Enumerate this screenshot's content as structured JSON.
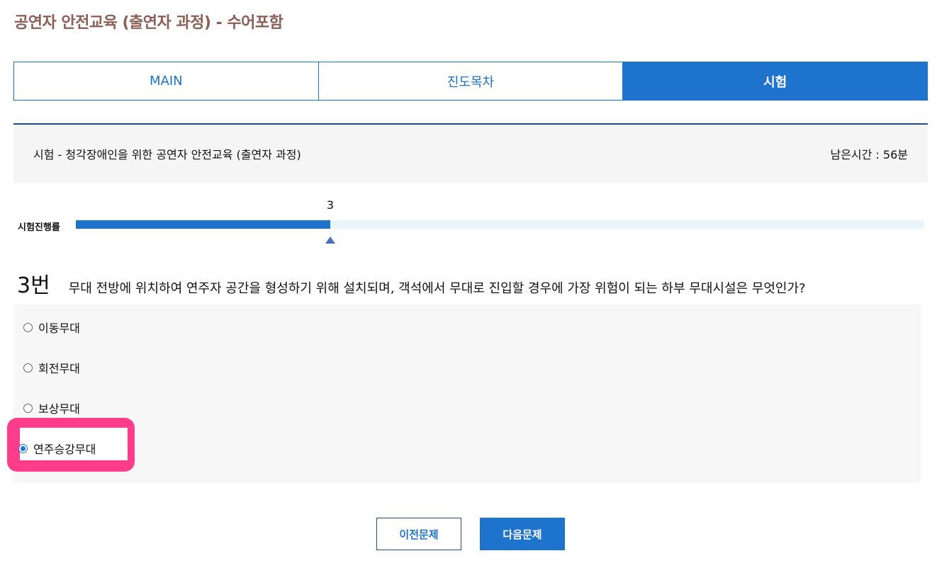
{
  "page": {
    "title": "공연자 안전교육 (출연자 과정) - 수어포함"
  },
  "tabs": [
    {
      "label": "MAIN",
      "active": false
    },
    {
      "label": "진도목차",
      "active": false
    },
    {
      "label": "시험",
      "active": true
    }
  ],
  "exam": {
    "title": "시험 - 청각장애인을 위한 공연자 안전교육 (출연자 과정)",
    "remaining_time": "남은시간 : 56분"
  },
  "progress": {
    "label": "시험진행률",
    "current": "3",
    "fraction": 0.3
  },
  "question": {
    "number": "3번",
    "text": "무대 전방에 위치하여 연주자 공간을 형성하기 위해 설치되며, 객석에서 무대로 진입할 경우에 가장 위험이 되는 하부 무대시설은 무엇인가?",
    "options": [
      {
        "label": "이동무대",
        "checked": false
      },
      {
        "label": "회전무대",
        "checked": false
      },
      {
        "label": "보상무대",
        "checked": false
      },
      {
        "label": "연주승강무대",
        "checked": true
      }
    ]
  },
  "buttons": {
    "prev_label": "이전문제",
    "next_label": "다음문제"
  },
  "colors": {
    "accent": "#1e73cd",
    "title": "#8c5e55",
    "highlight": "#ff3d8b"
  }
}
